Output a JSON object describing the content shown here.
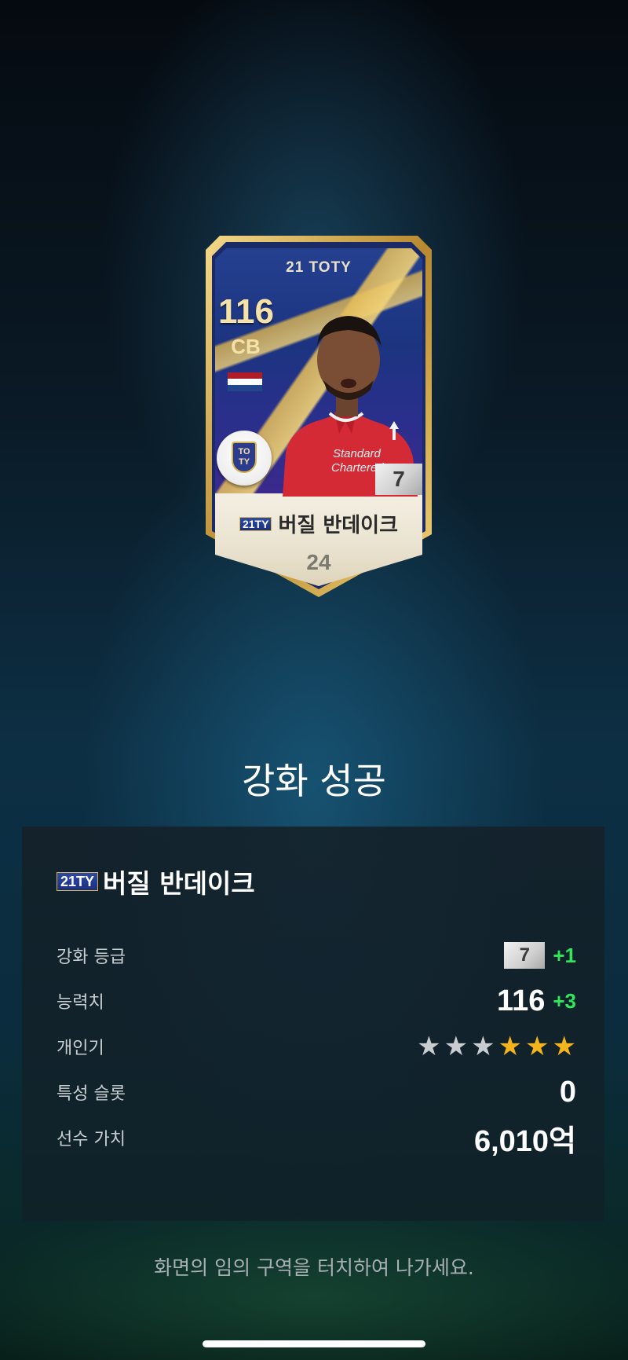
{
  "card": {
    "edition": "21 TOTY",
    "season_tag": "21TY",
    "overall": "116",
    "position": "CB",
    "player_name": "버질 반데이크",
    "grade": "7",
    "salary": "24",
    "club_badge_text": "TO TY"
  },
  "result": {
    "title": "강화 성공"
  },
  "panel": {
    "season_tag": "21TY",
    "player_name": "버질 반데이크",
    "stats": {
      "grade": {
        "label": "강화 등급",
        "value": "7",
        "delta": "+1"
      },
      "overall": {
        "label": "능력치",
        "value": "116",
        "delta": "+3"
      },
      "reputation": {
        "label": "개인기",
        "stars_total": 6,
        "stars_filled_gold": 3
      },
      "trait_slots": {
        "label": "특성 슬롯",
        "value": "0"
      },
      "player_value": {
        "label": "선수 가치",
        "value": "6,010억"
      }
    }
  },
  "footer": {
    "hint": "화면의 임의 구역을 터치하여 나가세요."
  },
  "colors": {
    "delta_green": "#2ee85a",
    "star_gold": "#f2b51c",
    "star_grey": "#c9ccd0",
    "card_gold": "#d8b24a",
    "card_blue": "#24408f"
  }
}
